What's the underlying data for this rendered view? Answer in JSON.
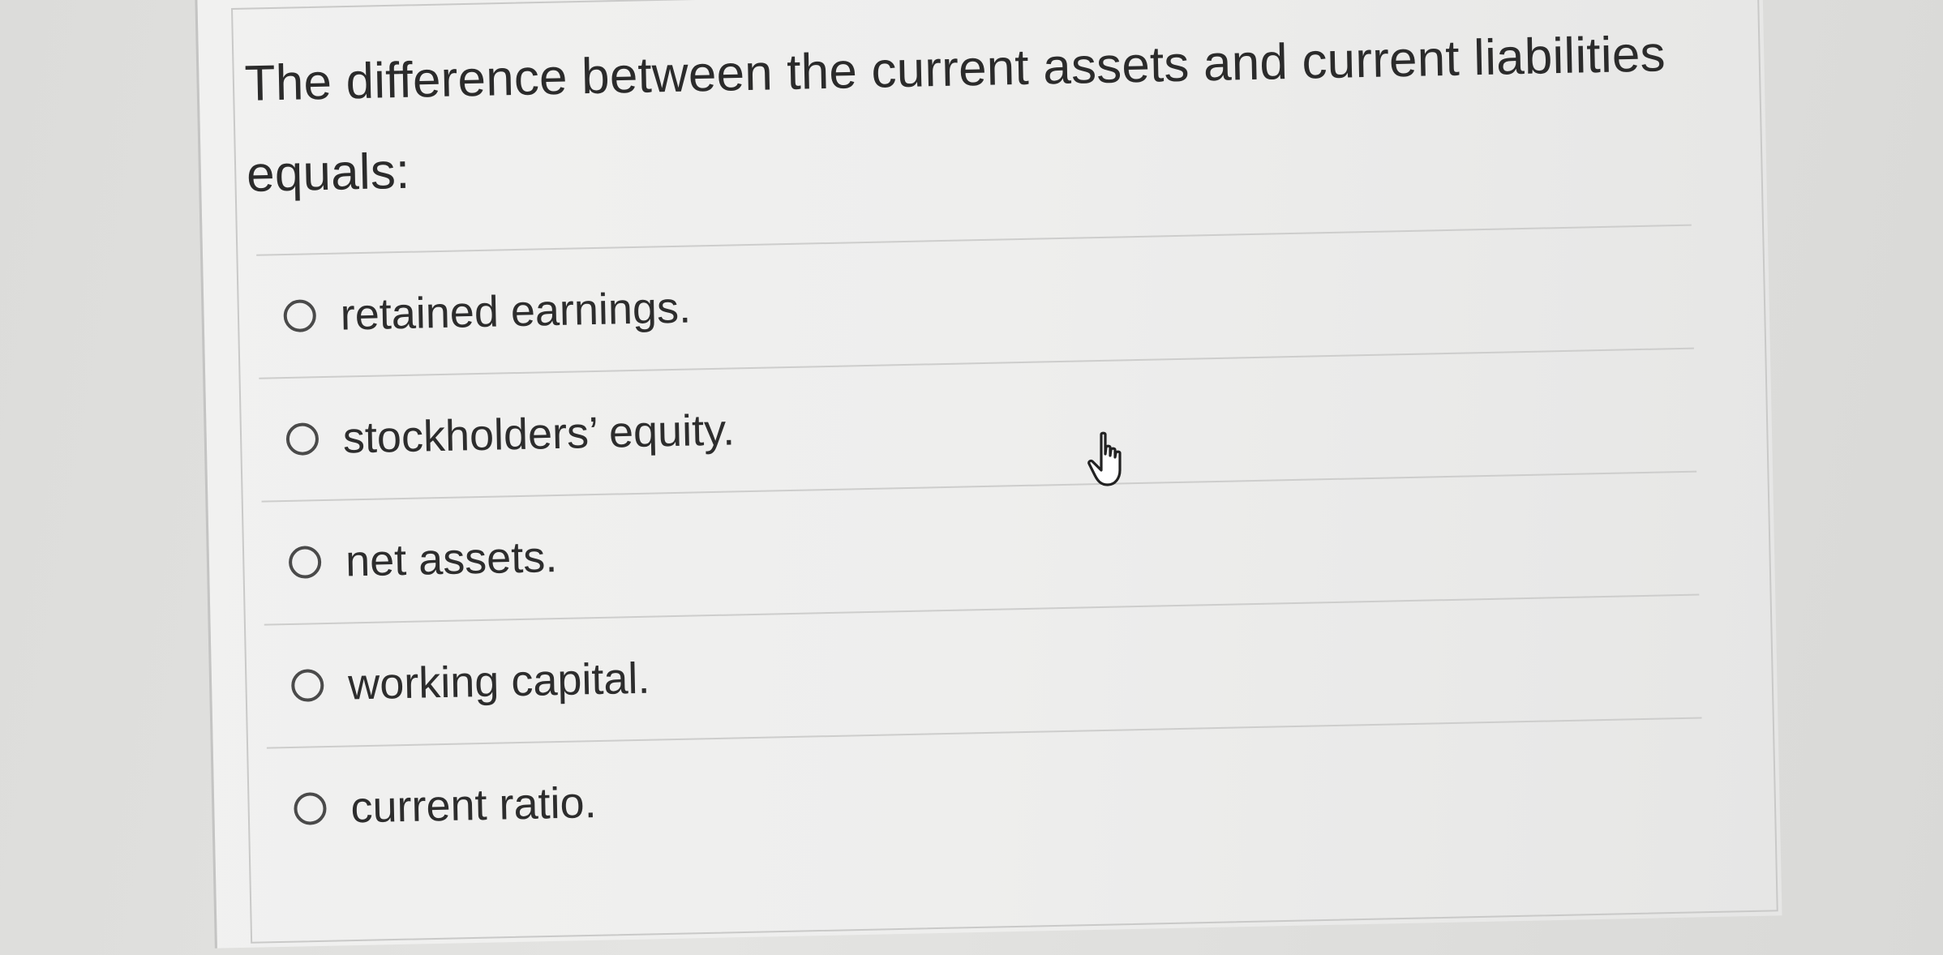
{
  "question": {
    "text": "The difference between the current assets and current liabilities equals:"
  },
  "options": [
    {
      "label": "retained earnings.",
      "selected": false
    },
    {
      "label": "stockholders’ equity.",
      "selected": false
    },
    {
      "label": "net assets.",
      "selected": false
    },
    {
      "label": "working capital.",
      "selected": false
    },
    {
      "label": "current ratio.",
      "selected": false
    }
  ],
  "cursor": {
    "icon": "hand-pointer-cursor-icon"
  }
}
